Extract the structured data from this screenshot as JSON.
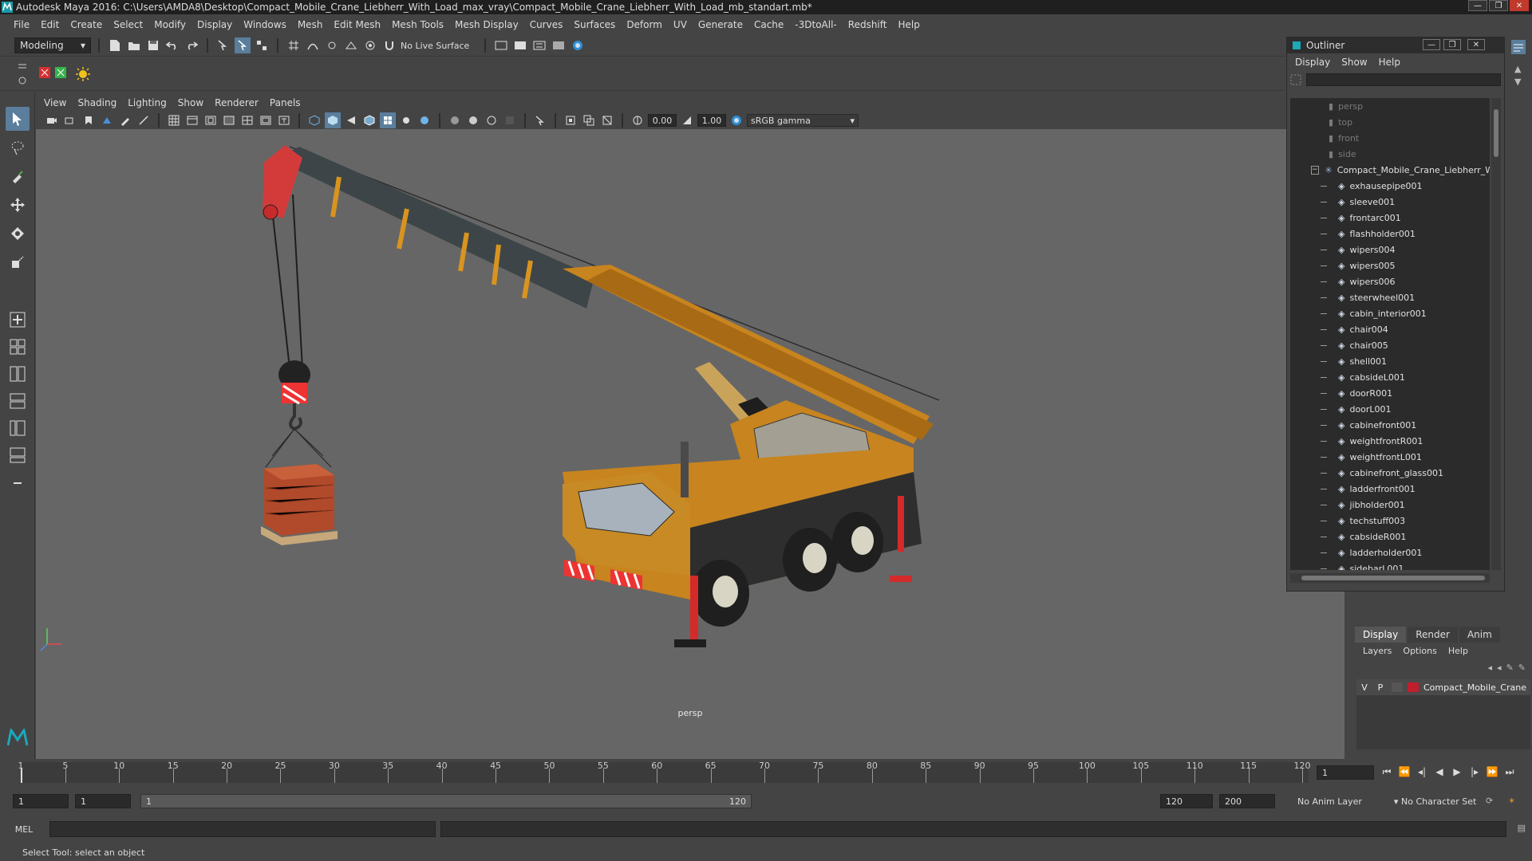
{
  "window": {
    "title": "Autodesk Maya 2016: C:\\Users\\AMDA8\\Desktop\\Compact_Mobile_Crane_Liebherr_With_Load_max_vray\\Compact_Mobile_Crane_Liebherr_With_Load_mb_standart.mb*",
    "buttons": [
      "—",
      "❐",
      "✕"
    ]
  },
  "menubar": [
    "File",
    "Edit",
    "Create",
    "Select",
    "Modify",
    "Display",
    "Windows",
    "Mesh",
    "Edit Mesh",
    "Mesh Tools",
    "Mesh Display",
    "Curves",
    "Surfaces",
    "Deform",
    "UV",
    "Generate",
    "Cache",
    "-3DtoAll-",
    "Redshift",
    "Help"
  ],
  "statusline": {
    "mode": "Modeling",
    "live_surface": "No Live Surface"
  },
  "viewport": {
    "menu": [
      "View",
      "Shading",
      "Lighting",
      "Show",
      "Renderer",
      "Panels"
    ],
    "exposure": "0.00",
    "gamma": "1.00",
    "color_space": "sRGB gamma",
    "camera": "persp"
  },
  "outliner": {
    "title": "Outliner",
    "menu": [
      "Display",
      "Show",
      "Help"
    ],
    "cameras": [
      "persp",
      "top",
      "front",
      "side"
    ],
    "group": "Compact_Mobile_Crane_Liebherr_W",
    "children": [
      "exhausepipe001",
      "sleeve001",
      "frontarc001",
      "flashholder001",
      "wipers004",
      "wipers005",
      "wipers006",
      "steerwheel001",
      "cabin_interior001",
      "chair004",
      "chair005",
      "shell001",
      "cabsideL001",
      "doorR001",
      "doorL001",
      "cabinefront001",
      "weightfrontR001",
      "weightfrontL001",
      "cabinefront_glass001",
      "ladderfront001",
      "jibholder001",
      "techstuff003",
      "cabsideR001",
      "ladderholder001",
      "sidebarL001"
    ]
  },
  "layers": {
    "tabs": [
      "Display",
      "Render",
      "Anim"
    ],
    "menu": [
      "Layers",
      "Options",
      "Help"
    ],
    "row": {
      "v": "V",
      "p": "P",
      "name": "Compact_Mobile_Crane",
      "color": "#c01e2e"
    }
  },
  "timeline": {
    "ticks": [
      "5",
      "10",
      "15",
      "20",
      "25",
      "30",
      "35",
      "40",
      "45",
      "50",
      "55",
      "60",
      "65",
      "70",
      "75",
      "80",
      "85",
      "90",
      "95",
      "100",
      "105",
      "110",
      "115",
      "120"
    ],
    "start_label": "1",
    "current_frame": "1",
    "range_start": "1",
    "range_inner_start": "1",
    "range_slider_start": "1",
    "range_slider_end": "120",
    "range_end": "120",
    "anim_end": "200",
    "anim_layer": "No Anim Layer",
    "character_set": "No Character Set"
  },
  "cmd": {
    "label": "MEL"
  },
  "help_line": "Select Tool: select an object",
  "colors": {
    "crane": "#c8841e",
    "accent": "#5a7e9c",
    "red": "#c01e2e",
    "viewport_bg": "#666666"
  }
}
